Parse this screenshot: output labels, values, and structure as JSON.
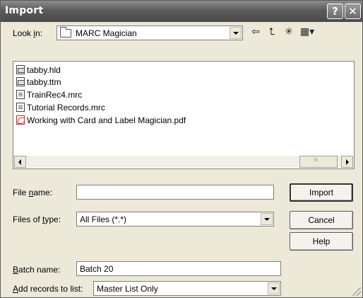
{
  "window": {
    "title": "Import",
    "help_glyph": "?",
    "close_glyph": "✕"
  },
  "look_in": {
    "label_pre": "Look ",
    "label_key": "i",
    "label_post": "n:",
    "value": "MARC Magician",
    "icons": [
      "folder-icon",
      "back-arrow-icon",
      "up-folder-icon",
      "new-folder-icon",
      "view-menu-icon"
    ]
  },
  "toolbar": {
    "back_glyph": "⇦",
    "up_glyph": "⮤",
    "new_glyph": "✳",
    "view_glyph": "▦▾"
  },
  "files": [
    {
      "name": "tabby.hld",
      "icon": "data"
    },
    {
      "name": "tabby.ttm",
      "icon": "data"
    },
    {
      "name": "TrainRec4.mrc",
      "icon": "doc"
    },
    {
      "name": "Tutorial Records.mrc",
      "icon": "doc"
    },
    {
      "name": "Working with Card and Label Magician.pdf",
      "icon": "pdf"
    }
  ],
  "file_name": {
    "label_pre": "File ",
    "label_key": "n",
    "label_post": "ame:",
    "value": ""
  },
  "files_of_type": {
    "label_pre": "Files of ",
    "label_key": "t",
    "label_post": "ype:",
    "value": "All Files (*.*)"
  },
  "batch_name": {
    "label_key": "B",
    "label_post": "atch name:",
    "value": "Batch 20"
  },
  "add_records": {
    "label_key": "A",
    "label_post": "dd records to list:",
    "value": "Master List Only"
  },
  "buttons": {
    "import": "Import",
    "cancel": "Cancel",
    "help": "Help"
  }
}
